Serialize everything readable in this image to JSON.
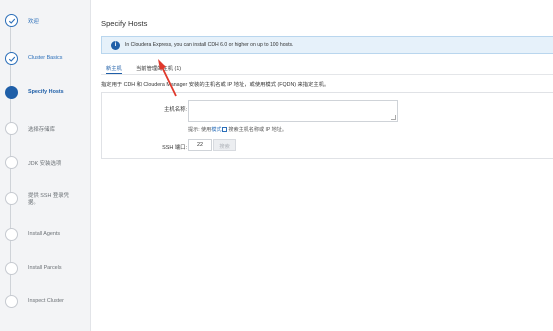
{
  "sidebar": {
    "steps": [
      {
        "label": "欢迎",
        "state": "done"
      },
      {
        "label": "Cluster Basics",
        "state": "done"
      },
      {
        "label": "Specify Hosts",
        "state": "active"
      },
      {
        "label": "选择存储库",
        "state": "pending"
      },
      {
        "label": "JDK 安装选项",
        "state": "pending"
      },
      {
        "label": "提供 SSH 登录凭据。",
        "state": "pending"
      },
      {
        "label": "Install Agents",
        "state": "pending"
      },
      {
        "label": "Install Parcels",
        "state": "pending"
      },
      {
        "label": "Inspect Cluster",
        "state": "pending"
      }
    ]
  },
  "main": {
    "title": "Specify Hosts",
    "info_banner": "In Cloudera Express, you can install CDH 6.0 or higher on up to 100 hosts.",
    "tabs": [
      {
        "label": "新主机",
        "active": true
      },
      {
        "label": "当前管理的主机 (1)",
        "active": false
      }
    ],
    "instructions": "指定用于 CDH 和 Cloudera Manager 安装的主机名或 IP 地址，或使用模式 (FQDN) 来指定主机。",
    "form": {
      "hostname_label": "主机名称:",
      "hostname_value": "",
      "hint_prefix": "提示: 使用",
      "hint_link": "模式",
      "hint_suffix": "搜索主机名称或 IP 地址。",
      "ssh_label": "SSH 端口:",
      "ssh_value": "22",
      "search_button": "搜索"
    }
  },
  "colors": {
    "accent": "#1f5fa8",
    "banner_bg": "#e6f1fa",
    "annotation_arrow": "#e0382b"
  }
}
